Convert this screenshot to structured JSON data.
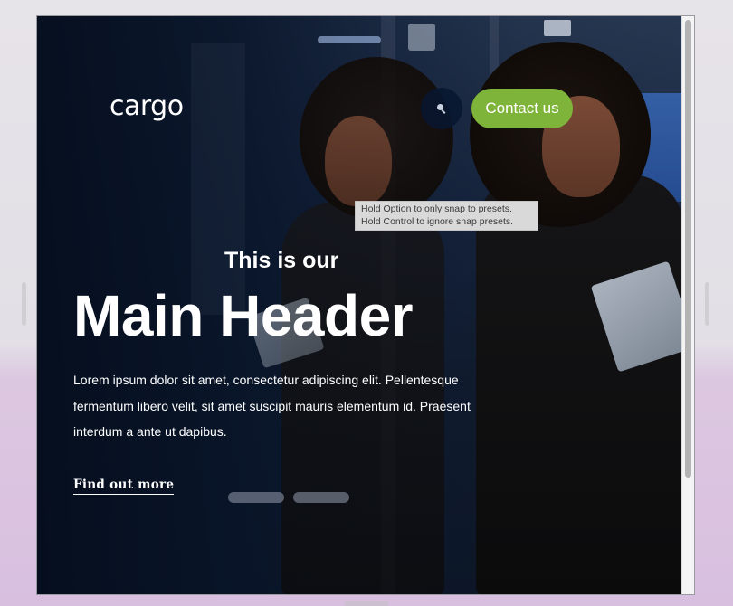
{
  "brand": {
    "logo_text": "cargo"
  },
  "nav": {
    "search_icon": "search-icon",
    "contact_label": "Contact us",
    "contact_color": "#7fb43a"
  },
  "tooltip": {
    "line1": "Hold Option to only snap to presets.",
    "line2": "Hold Control to ignore snap presets."
  },
  "hero": {
    "subheader": "This is our",
    "header": "Main Header",
    "body": "Lorem ipsum dolor sit amet, consectetur adipiscing elit. Pellentesque fermentum libero velit, sit amet suscipit mauris elementum id. Praesent interdum a ante ut dapibus.",
    "cta_label": "Find out more"
  },
  "slider": {
    "slide_count": 2
  }
}
